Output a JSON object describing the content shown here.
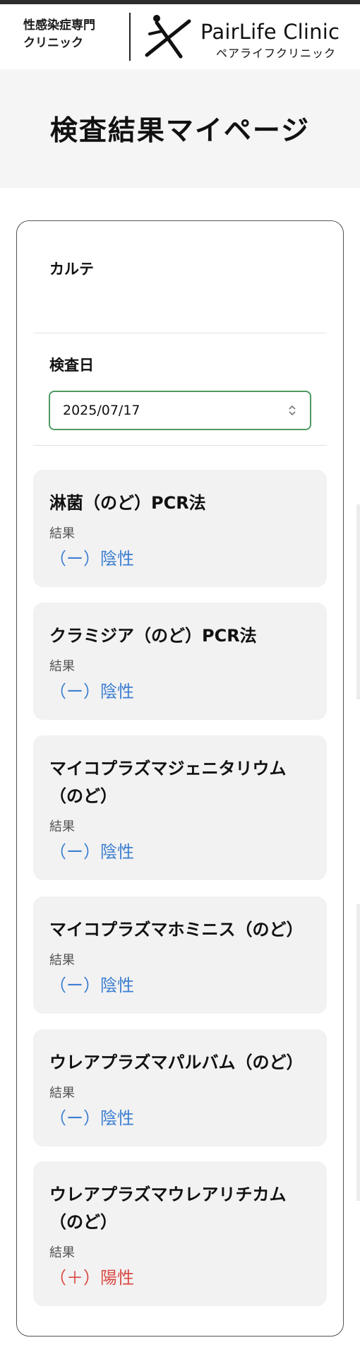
{
  "header": {
    "tagline_line1": "性感染症専門",
    "tagline_line2": "クリニック",
    "brand_name": "PairLife Clinic",
    "brand_sub": "ペアライフクリニック"
  },
  "hero": {
    "title": "検査結果マイページ"
  },
  "karte": {
    "label": "カルテ",
    "value": ""
  },
  "exam_date": {
    "label": "検査日",
    "selected": "2025/07/17"
  },
  "results": [
    {
      "name": "淋菌（のど）PCR法",
      "label": "結果",
      "value": "（ー）陰性",
      "status": "negative"
    },
    {
      "name": "クラミジア（のど）PCR法",
      "label": "結果",
      "value": "（ー）陰性",
      "status": "negative"
    },
    {
      "name": "マイコプラズマジェニタリウム（のど）",
      "label": "結果",
      "value": "（ー）陰性",
      "status": "negative"
    },
    {
      "name": "マイコプラズマホミニス（のど）",
      "label": "結果",
      "value": "（ー）陰性",
      "status": "negative"
    },
    {
      "name": "ウレアプラズマパルバム（のど）",
      "label": "結果",
      "value": "（ー）陰性",
      "status": "negative"
    },
    {
      "name": "ウレアプラズマウレアリチカム（のど）",
      "label": "結果",
      "value": "（＋）陽性",
      "status": "positive"
    }
  ],
  "colors": {
    "negative": "#3d7fd1",
    "positive": "#d94a45",
    "select_border": "#4f9a5f"
  }
}
